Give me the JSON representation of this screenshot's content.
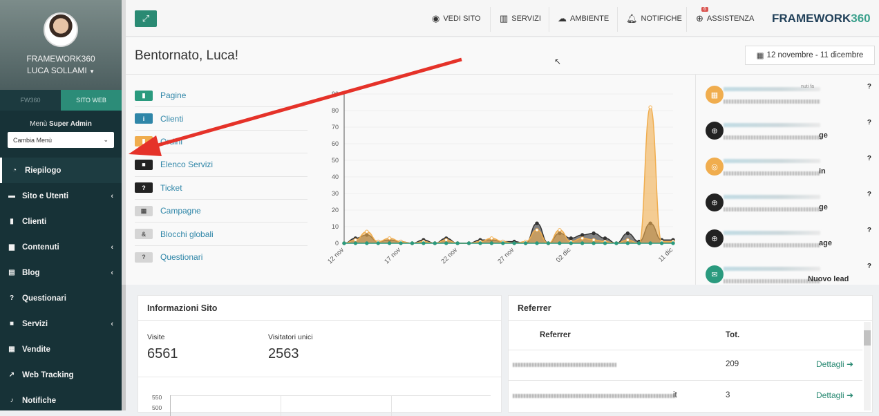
{
  "sidebar": {
    "org_name": "FRAMEWORK360",
    "user_name": "LUCA SOLLAMI",
    "tabs": [
      {
        "label": "FW360"
      },
      {
        "label": "SITO WEB"
      }
    ],
    "menu_title_prefix": "Menù",
    "menu_title_bold": "Super Admin",
    "menu_select": "Cambia Menù",
    "items": [
      {
        "label": "Riepilogo",
        "icon": "gauge-icon"
      },
      {
        "label": "Sito e Utenti",
        "icon": "sitemap-icon"
      },
      {
        "label": "Clienti",
        "icon": "user-icon"
      },
      {
        "label": "Contenuti",
        "icon": "file-icon"
      },
      {
        "label": "Blog",
        "icon": "document-icon"
      },
      {
        "label": "Questionari",
        "icon": "question-icon"
      },
      {
        "label": "Servizi",
        "icon": "briefcase-icon"
      },
      {
        "label": "Vendite",
        "icon": "calculator-icon"
      },
      {
        "label": "Web Tracking",
        "icon": "chart-icon"
      },
      {
        "label": "Notifiche",
        "icon": "bell-icon"
      }
    ]
  },
  "topbar": {
    "vedi_sito": "VEDI SITO",
    "servizi": "SERVIZI",
    "ambiente": "AMBIENTE",
    "notifiche": "NOTIFICHE",
    "assistenza": "ASSISTENZA",
    "assistenza_badge": "6",
    "brand_a": "FRAMEWORK",
    "brand_b": "360"
  },
  "main": {
    "welcome": "Bentornato, Luca!",
    "date_range": "12 novembre - 11 dicembre",
    "quick_links": [
      {
        "label": "Pagine",
        "color": "#2a9a7e",
        "glyph": "▮"
      },
      {
        "label": "Clienti",
        "color": "#2f86a8",
        "glyph": "i"
      },
      {
        "label": "Ordini",
        "color": "#f0ad4e",
        "glyph": "▮"
      },
      {
        "label": "Elenco Servizi",
        "color": "#222222",
        "glyph": "■"
      },
      {
        "label": "Ticket",
        "color": "#222222",
        "glyph": "?"
      },
      {
        "label": "Campagne",
        "color": "#d5d5d5",
        "glyph": "▦"
      },
      {
        "label": "Blocchi globali",
        "color": "#d5d5d5",
        "glyph": "&"
      },
      {
        "label": "Questionari",
        "color": "#d5d5d5",
        "glyph": "?"
      }
    ]
  },
  "chart_data": {
    "type": "area",
    "categories": [
      "12 nov",
      "13 nov",
      "14 nov",
      "15 nov",
      "16 nov",
      "17 nov",
      "18 nov",
      "19 nov",
      "20 nov",
      "21 nov",
      "22 nov",
      "23 nov",
      "24 nov",
      "25 nov",
      "26 nov",
      "27 nov",
      "28 nov",
      "29 nov",
      "30 nov",
      "01 dic",
      "02 dic",
      "03 dic",
      "04 dic",
      "05 dic",
      "06 dic",
      "07 dic",
      "08 dic",
      "09 dic",
      "10 dic",
      "11 dic"
    ],
    "x_tick_labels": [
      "12 nov",
      "17 nov",
      "22 nov",
      "27 nov",
      "02 dic",
      "11 dic"
    ],
    "y_ticks": [
      0,
      10,
      20,
      30,
      40,
      50,
      60,
      70,
      80,
      90
    ],
    "ylim": [
      0,
      90
    ],
    "series": [
      {
        "color": "#f0ad4e",
        "values": [
          0,
          2,
          7,
          1,
          3,
          1,
          0,
          1,
          0,
          2,
          0,
          0,
          1,
          3,
          1,
          0,
          1,
          8,
          0,
          8,
          1,
          3,
          2,
          1,
          0,
          2,
          0,
          82,
          1,
          1
        ]
      },
      {
        "color": "#333333",
        "values": [
          0,
          3,
          5,
          1,
          2,
          1,
          0,
          2,
          0,
          3,
          0,
          0,
          2,
          2,
          1,
          1,
          0,
          12,
          0,
          6,
          3,
          5,
          6,
          3,
          0,
          6,
          1,
          12,
          2,
          2
        ]
      },
      {
        "color": "#2a9a7e",
        "values": [
          0,
          0,
          0,
          0,
          0,
          0,
          0,
          0,
          0,
          0,
          0,
          0,
          0,
          0,
          0,
          0,
          0,
          0,
          0,
          0,
          0,
          0,
          0,
          0,
          0,
          0,
          0,
          0,
          0,
          0
        ]
      }
    ]
  },
  "feed": {
    "items": [
      {
        "icon": "calendar-icon",
        "color": "#f0ad4e",
        "suffix": "",
        "small": "nuti fa"
      },
      {
        "icon": "globe-icon",
        "color": "#222222",
        "suffix": "ge",
        "small": ""
      },
      {
        "icon": "target-icon",
        "color": "#f0ad4e",
        "suffix": "in",
        "small": ""
      },
      {
        "icon": "globe-icon",
        "color": "#222222",
        "suffix": "ge",
        "small": ""
      },
      {
        "icon": "globe-icon",
        "color": "#222222",
        "suffix": "age",
        "small": ""
      },
      {
        "icon": "envelope-icon",
        "color": "#2a9a7e",
        "suffix": "Nuovo lead",
        "small": ""
      }
    ]
  },
  "info": {
    "title": "Informazioni Sito",
    "visite_label": "Visite",
    "visite_value": "6561",
    "unici_label": "Visitatori unici",
    "unici_value": "2563",
    "mini_ticks": [
      "550",
      "500"
    ]
  },
  "referrer": {
    "title": "Referrer",
    "col_referrer": "Referrer",
    "col_tot": "Tot.",
    "rows": [
      {
        "suffix": "",
        "tot": "209",
        "action": "Dettagli"
      },
      {
        "suffix": "it",
        "tot": "3",
        "action": "Dettagli"
      }
    ]
  }
}
